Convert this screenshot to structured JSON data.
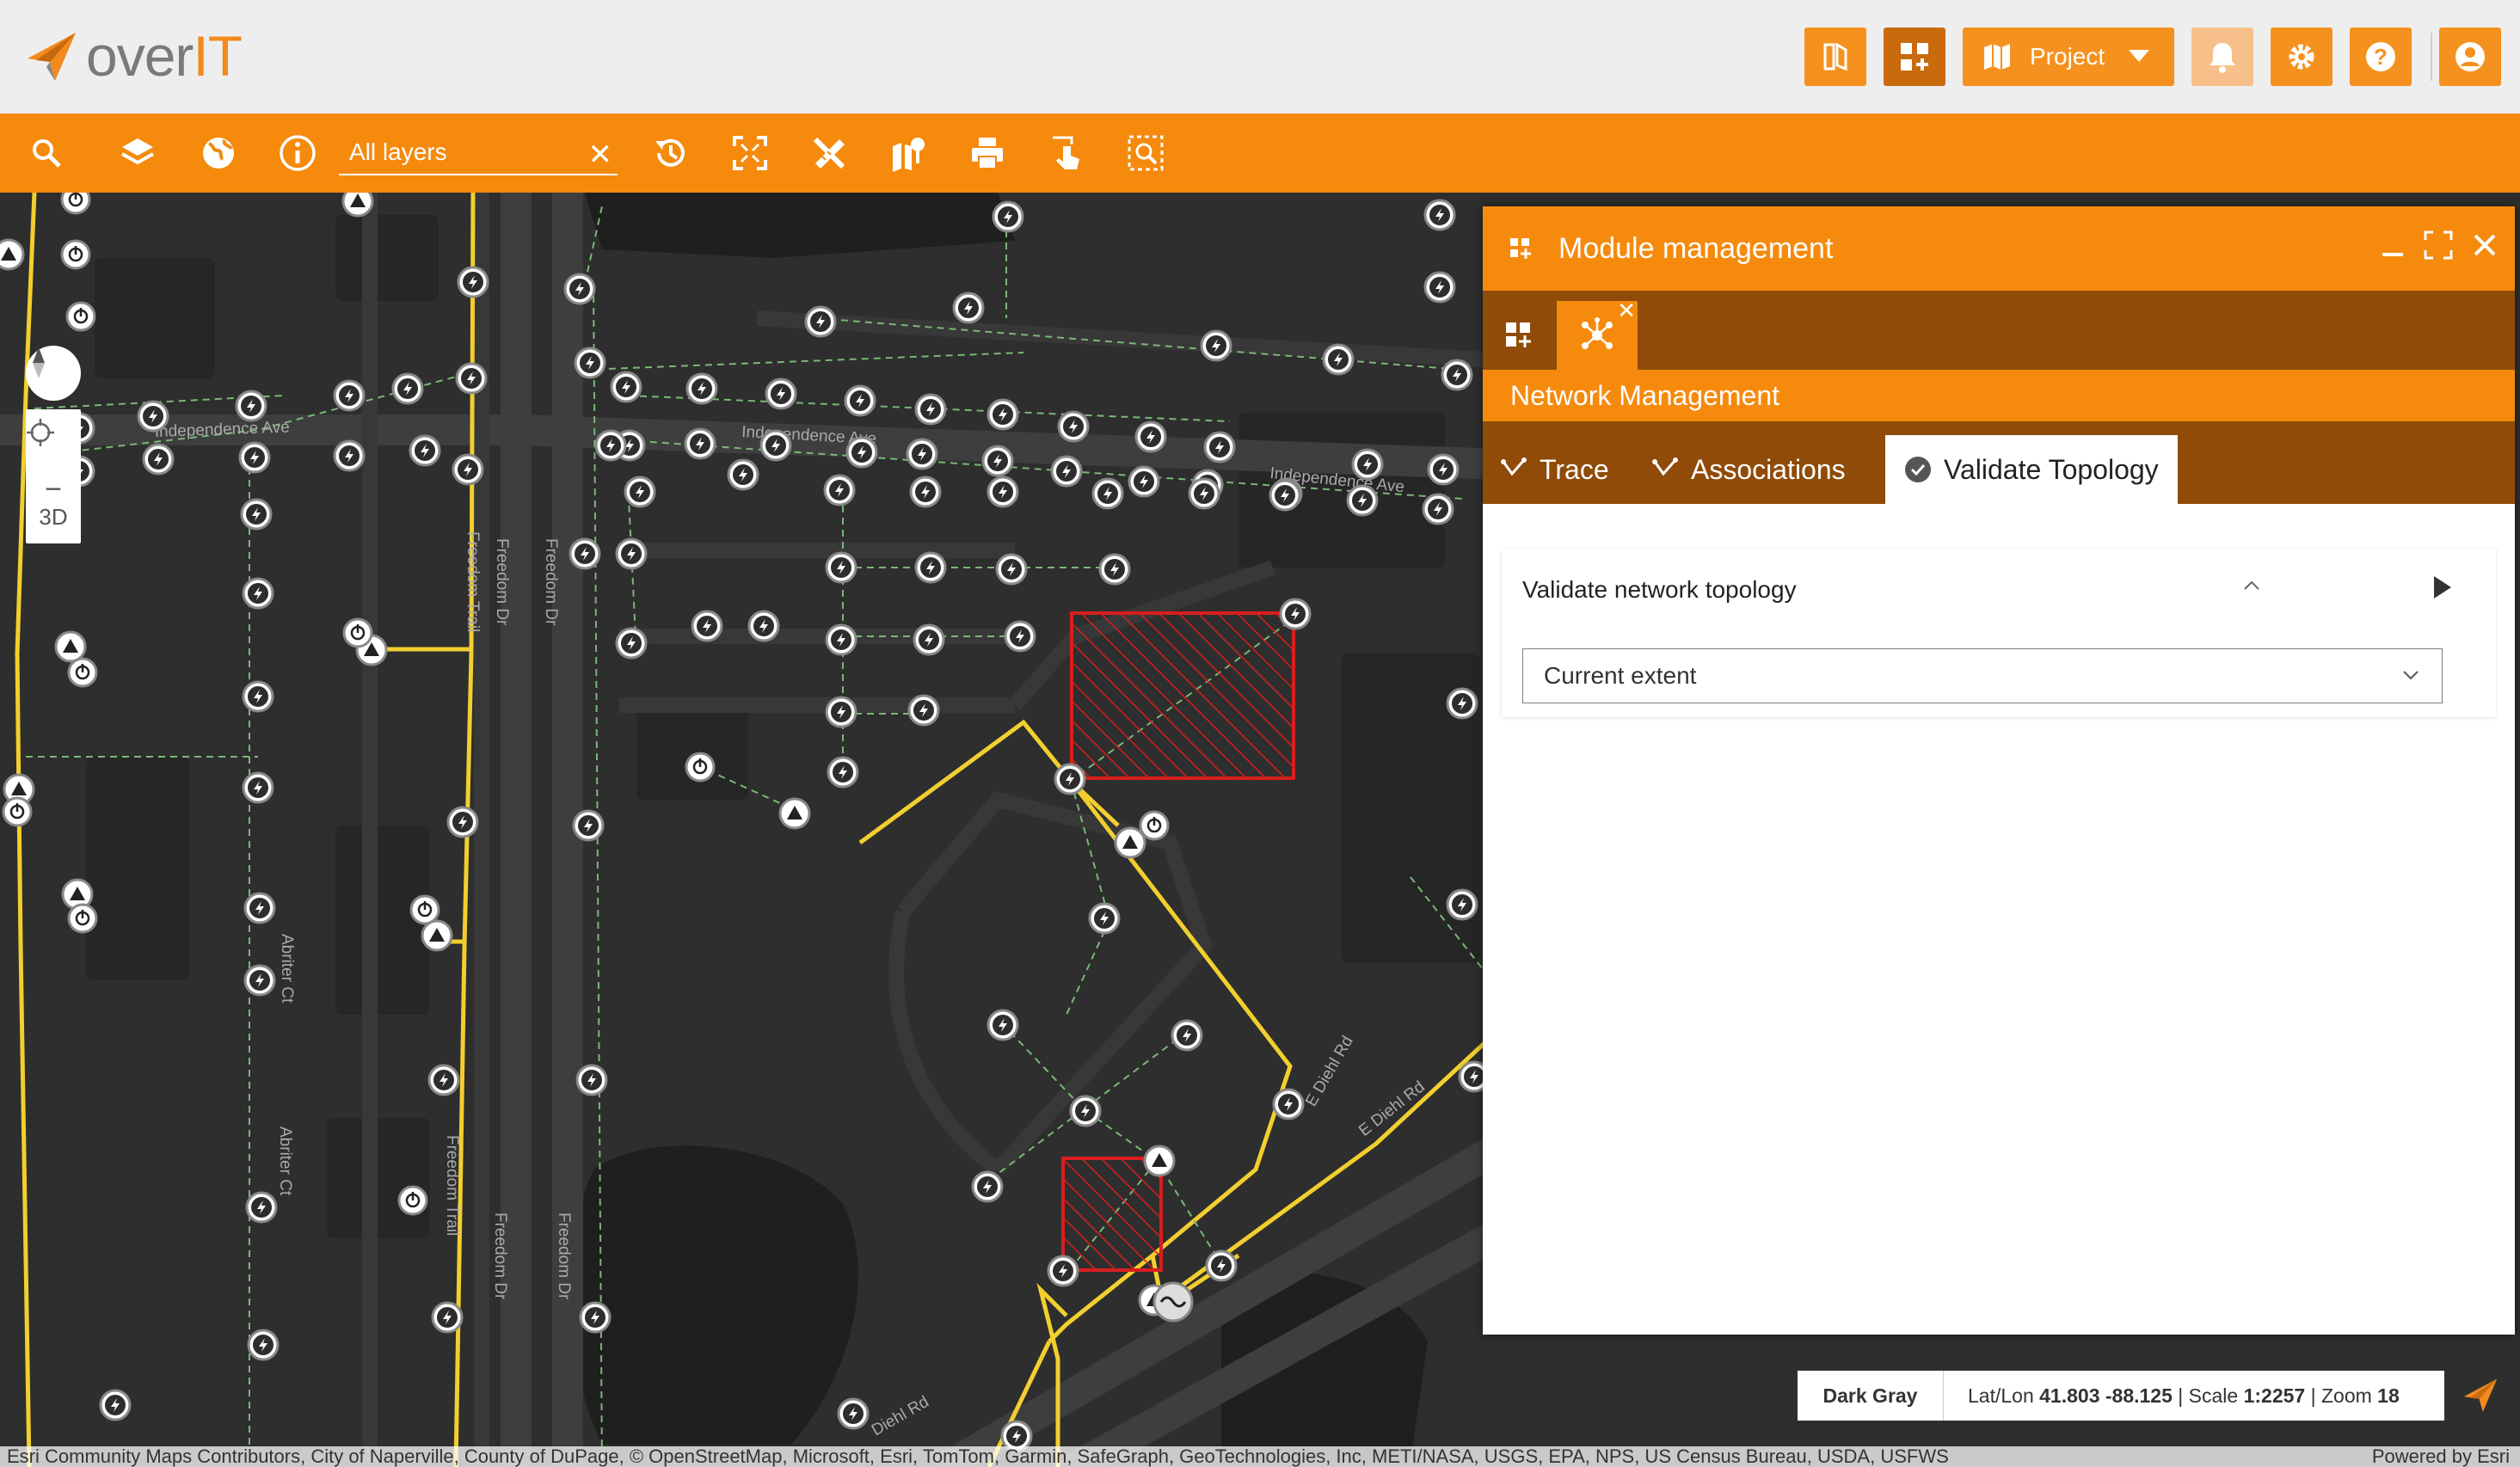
{
  "brand": {
    "name_a": "over",
    "name_b": "IT"
  },
  "header": {
    "project_label": "Project"
  },
  "toolbar": {
    "search_placeholder": "All layers",
    "clear_symbol": "✕"
  },
  "map_controls": {
    "zoom_in": "+",
    "zoom_out": "−",
    "mode_3d": "3D"
  },
  "street_labels": [
    "Independence Ave",
    "Independence Ave",
    "Independence Ave",
    "Freedom Dr",
    "Freedom Dr",
    "Freedom Dr",
    "Freedom Dr",
    "Freedom Trail",
    "Freedom Trail",
    "Abriter Ct",
    "Abriter Ct",
    "E Diehl Rd",
    "E Diehl Rd",
    "Diehl Rd"
  ],
  "panel": {
    "title": "Module management",
    "section_title": "Network Management",
    "tabs": [
      {
        "label": "Trace"
      },
      {
        "label": "Associations"
      },
      {
        "label": "Validate Topology"
      }
    ],
    "card": {
      "title": "Validate network topology",
      "extent_value": "Current extent"
    }
  },
  "status": {
    "basemap": "Dark Gray",
    "latlon_label": "Lat/Lon",
    "latlon_value": "41.803 -88.125",
    "scale_label": "Scale",
    "scale_value": "1:2257",
    "zoom_label": "Zoom",
    "zoom_value": "18"
  },
  "attribution": "Esri Community Maps Contributors, City of Naperville, County of DuPage, © OpenStreetMap, Microsoft, Esri, TomTom, Garmin, SafeGraph, GeoTechnologies, Inc, METI/NASA, USGS, EPA, NPS, US Census Bureau, USDA, USFWS",
  "powered_by": "Powered by Esri",
  "colors": {
    "brand_orange": "#f58a0d",
    "panel_brown": "#8f4b07",
    "network_line": "#f2cf2f",
    "validation_error": "#d81e1e"
  }
}
